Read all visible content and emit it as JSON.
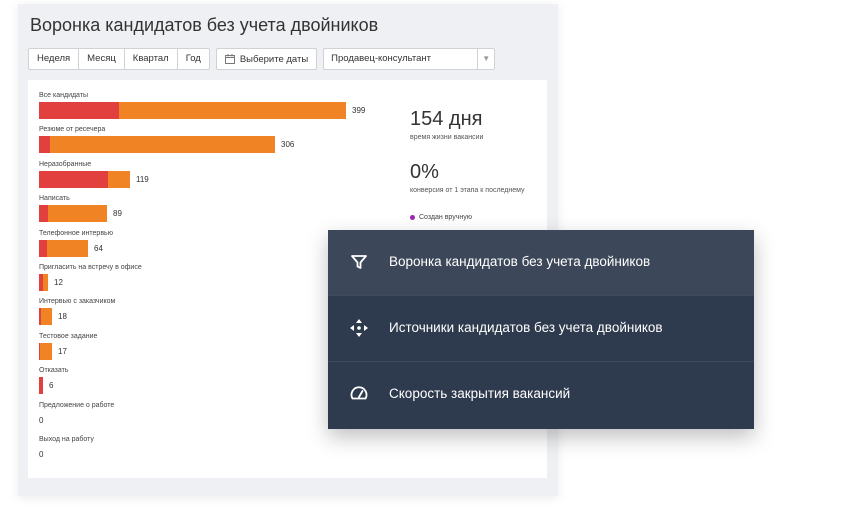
{
  "title": "Воронка кандидатов без учета двойников",
  "toolbar": {
    "periods": [
      "Неделя",
      "Месяц",
      "Квартал",
      "Год"
    ],
    "date_button": "Выберите даты",
    "role_select": "Продавец-консультант"
  },
  "colors": {
    "red": "#e2403f",
    "orange": "#f08424"
  },
  "funnel": [
    {
      "label": "Все кандидаты",
      "value": "399",
      "red": 80,
      "orange": 227
    },
    {
      "label": "Резюме от ресечера",
      "value": "306",
      "red": 11,
      "orange": 225
    },
    {
      "label": "Неразобранные",
      "value": "119",
      "red": 69,
      "orange": 22
    },
    {
      "label": "Написать",
      "value": "89",
      "red": 9,
      "orange": 59
    },
    {
      "label": "Телефонное интервью",
      "value": "64",
      "red": 8,
      "orange": 41
    },
    {
      "label": "Пригласить на встречу в офисе",
      "value": "12",
      "red": 4,
      "orange": 5
    },
    {
      "label": "Интервью с заказчиком",
      "value": "18",
      "red": 2,
      "orange": 11
    },
    {
      "label": "Тестовое задание",
      "value": "17",
      "red": 1,
      "orange": 12
    },
    {
      "label": "Отказать",
      "value": "6",
      "red": 4,
      "orange": 0
    },
    {
      "label": "Предложение о работе",
      "value": "0",
      "red": 0,
      "orange": 0
    },
    {
      "label": "Выход на работу",
      "value": "0",
      "red": 0,
      "orange": 0
    }
  ],
  "stats": {
    "lifetime_value": "154 дня",
    "lifetime_label": "время жизни вакансии",
    "conversion_value": "0%",
    "conversion_label": "конверсия от 1 этапа к последнему",
    "legend_manual": "Создан вручную"
  },
  "menu": [
    {
      "label": "Воронка кандидатов без учета двойников",
      "icon": "filter-icon"
    },
    {
      "label": "Источники кандидатов без учета двойников",
      "icon": "move-arrows-icon"
    },
    {
      "label": "Скорость закрытия вакансий",
      "icon": "speedometer-icon"
    }
  ]
}
